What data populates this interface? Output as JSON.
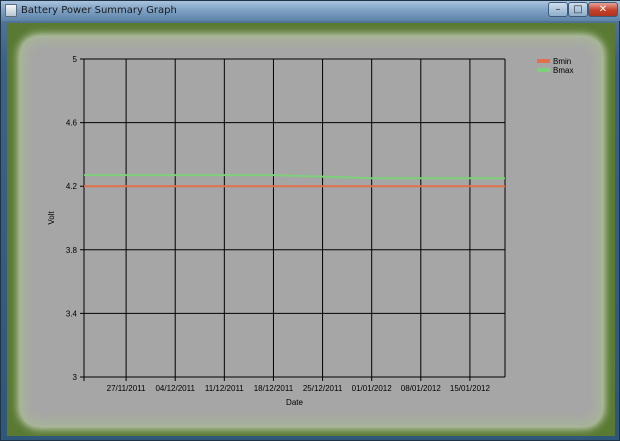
{
  "window": {
    "title": "Battery Power Summary Graph",
    "controls": {
      "minimize": "–",
      "maximize": "□",
      "close": "✕"
    },
    "frame_color": "#5a7a33",
    "panel_color": "#a6a6a6"
  },
  "chart_data": {
    "type": "line",
    "xlabel": "Date",
    "ylabel": "Volt",
    "ylim": [
      3,
      5
    ],
    "xlim": [
      "2011-11-21",
      "2012-01-20"
    ],
    "y_ticks": [
      "3",
      "3.4",
      "3.8",
      "4.2",
      "4.6",
      "5"
    ],
    "x_ticks": [
      "27/11/2011",
      "04/12/2011",
      "11/12/2011",
      "18/12/2011",
      "25/12/2011",
      "01/01/2012",
      "08/01/2012",
      "15/01/2012"
    ],
    "grid": true,
    "legend_position": "top-right",
    "series": [
      {
        "name": "Bmin",
        "color": "#e2704a",
        "x": [
          "2011-11-21",
          "2011-11-27",
          "2011-12-04",
          "2011-12-11",
          "2011-12-18",
          "2011-12-25",
          "2012-01-01",
          "2012-01-08",
          "2012-01-15",
          "2012-01-20"
        ],
        "values": [
          4.2,
          4.2,
          4.2,
          4.2,
          4.2,
          4.2,
          4.2,
          4.2,
          4.2,
          4.2
        ]
      },
      {
        "name": "Bmax",
        "color": "#7fd07a",
        "x": [
          "2011-11-21",
          "2011-11-27",
          "2011-12-04",
          "2011-12-11",
          "2011-12-18",
          "2011-12-25",
          "2012-01-01",
          "2012-01-08",
          "2012-01-15",
          "2012-01-20"
        ],
        "values": [
          4.27,
          4.27,
          4.27,
          4.27,
          4.27,
          4.26,
          4.25,
          4.25,
          4.25,
          4.25
        ]
      }
    ]
  }
}
